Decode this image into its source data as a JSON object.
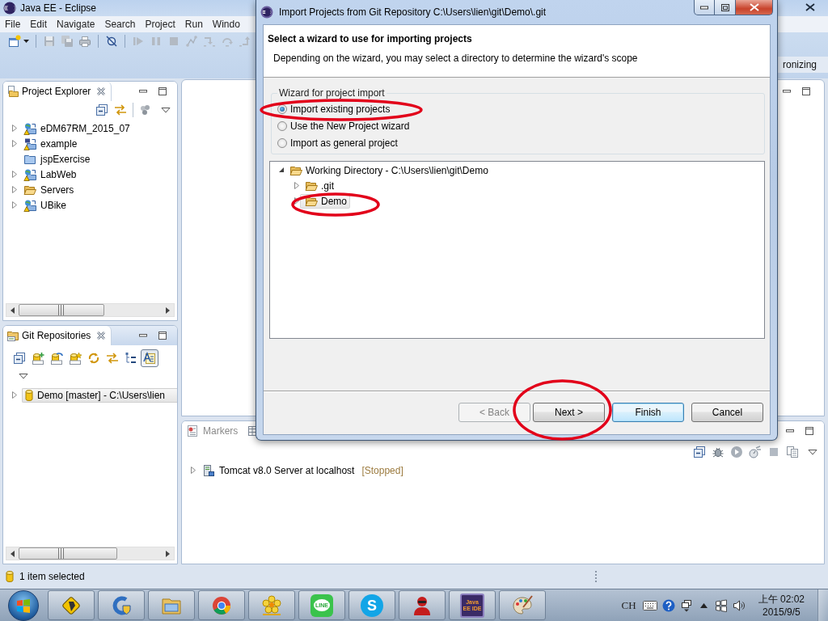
{
  "window": {
    "title": "Java EE - Eclipse"
  },
  "menu": [
    "File",
    "Edit",
    "Navigate",
    "Search",
    "Project",
    "Run",
    "Windo"
  ],
  "perspective_bar": {
    "label": "ronizing"
  },
  "project_explorer": {
    "title": "Project Explorer",
    "active": false,
    "items": [
      {
        "label": "eDM67RM_2015_07",
        "kind": "web-project",
        "expanded": false,
        "selected": false
      },
      {
        "label": "example",
        "kind": "maven-project",
        "expanded": false,
        "selected": false
      },
      {
        "label": "jspExercise",
        "kind": "closed-project",
        "selected": false
      },
      {
        "label": "LabWeb",
        "kind": "web-project",
        "expanded": false,
        "selected": false
      },
      {
        "label": "Servers",
        "kind": "folder",
        "expanded": false,
        "selected": false
      },
      {
        "label": "UBike",
        "kind": "web-project",
        "expanded": false,
        "selected": false
      }
    ]
  },
  "git_repositories": {
    "title": "Git Repositories",
    "active": true,
    "items": [
      {
        "label": "Demo [master] - C:\\Users\\lien",
        "expanded": false,
        "selected": true
      }
    ]
  },
  "servers_view": {
    "active": false,
    "tabs": [
      {
        "label": "Markers",
        "selected": false
      }
    ],
    "items": [
      {
        "label": "Tomcat v8.0 Server at localhost",
        "status": "[Stopped]",
        "expanded": false,
        "selected": false
      }
    ]
  },
  "status_bar": {
    "text": "1 item selected"
  },
  "dialog": {
    "title": "Import Projects from Git Repository C:\\Users\\lien\\git\\Demo\\.git",
    "heading": "Select a wizard to use for importing projects",
    "description": "Depending on the wizard, you may select a directory to determine the wizard's scope",
    "group_label": "Wizard for project import",
    "options": [
      {
        "label": "Import existing projects",
        "selected": true,
        "circled": true
      },
      {
        "label": "Use the New Project wizard",
        "selected": false,
        "circled": false
      },
      {
        "label": "Import as general project",
        "selected": false,
        "circled": false
      }
    ],
    "tree": [
      {
        "label": "Working Directory - C:\\Users\\lien\\git\\Demo",
        "expanded": true,
        "selected": false,
        "circled": false,
        "children": [
          {
            "label": ".git",
            "expanded": false,
            "selected": false,
            "circled": false
          },
          {
            "label": "Demo",
            "expanded": false,
            "selected": true,
            "circled": true
          }
        ]
      }
    ],
    "buttons": [
      {
        "label": "< Back",
        "disabled": true,
        "default": false,
        "circled": false
      },
      {
        "label": "Next >",
        "disabled": false,
        "default": false,
        "circled": true
      },
      {
        "label": "Finish",
        "disabled": false,
        "default": true,
        "circled": false
      },
      {
        "label": "Cancel",
        "disabled": false,
        "default": false,
        "circled": false
      }
    ]
  },
  "taskbar": {
    "apps": [
      {
        "kind": "diamond"
      },
      {
        "kind": "shield"
      },
      {
        "kind": "folder"
      },
      {
        "kind": "ring"
      },
      {
        "kind": "flower"
      },
      {
        "kind": "chat",
        "label": "LINE"
      },
      {
        "kind": "phone",
        "label": "S"
      },
      {
        "kind": "person"
      },
      {
        "kind": "ide",
        "label": "Java EE IDE"
      },
      {
        "kind": "palette"
      }
    ],
    "tray": {
      "language": "CH",
      "time": "上午 02:02",
      "date": "2015/9/5"
    }
  }
}
